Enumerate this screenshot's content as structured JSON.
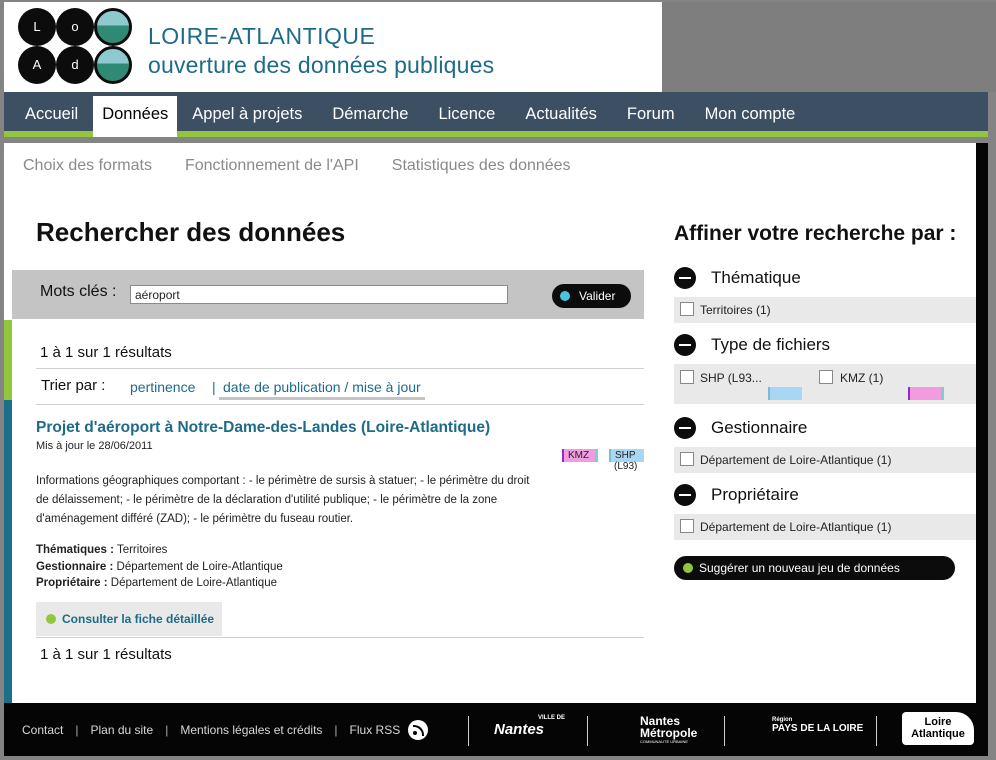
{
  "header": {
    "logo_letters": [
      "L",
      "o",
      "A",
      "d"
    ],
    "title_line1": "LOIRE-ATLANTIQUE",
    "title_line2": "ouverture des données publiques"
  },
  "nav": {
    "items": [
      "Accueil",
      "Données",
      "Appel à projets",
      "Démarche",
      "Licence",
      "Actualités",
      "Forum",
      "Mon compte"
    ],
    "active": "Données"
  },
  "subnav": [
    "Choix des formats",
    "Fonctionnement de l'API",
    "Statistiques des données"
  ],
  "search": {
    "page_title": "Rechercher des données",
    "keywords_label": "Mots clés :",
    "keywords_value": "aéroport",
    "submit_label": "Valider"
  },
  "results": {
    "count_text": "1 à 1 sur 1 résultats",
    "sort_label": "Trier par :",
    "sort_options": [
      "pertinence",
      "date de publication / mise à jour"
    ],
    "sort_separator": "|",
    "item": {
      "title": "Projet d'aéroport à Notre-Dame-des-Landes (Loire-Atlantique)",
      "updated": "Mis à jour le  28/06/2011",
      "formats": [
        "KMZ",
        "SHP"
      ],
      "format_sub": "(L93)",
      "description": "Informations géographiques comportant : - le périmètre de sursis à statuer; - le périmètre du droit de délaissement; - le périmètre de la déclaration d'utilité publique; - le périmètre de la zone d'aménagement différé (ZAD); - le périmètre du fuseau routier.",
      "theme_label": "Thématiques :",
      "theme_value": " Territoires",
      "manager_label": "Gestionnaire :",
      "manager_value": " Département de Loire-Atlantique",
      "owner_label": "Propriétaire :",
      "owner_value": " Département de Loire-Atlantique",
      "details_button": "Consulter la fiche détaillée"
    }
  },
  "sidebar": {
    "title": "Affiner votre recherche par :",
    "facets": [
      {
        "label": "Thématique",
        "options": [
          "Territoires (1)"
        ]
      },
      {
        "label": "Type de fichiers",
        "options": [
          "SHP (L93...",
          "KMZ (1)"
        ]
      },
      {
        "label": "Gestionnaire",
        "options": [
          "Département de Loire-Atlantique (1)"
        ]
      },
      {
        "label": "Propriétaire",
        "options": [
          "Département de Loire-Atlantique (1)"
        ]
      }
    ],
    "suggest_button": "Suggérer un nouveau jeu de données"
  },
  "footer": {
    "links": [
      "Contact",
      "Plan du site",
      "Mentions légales et crédits",
      "Flux RSS"
    ],
    "separator": "|",
    "partners": [
      {
        "top": "VILLE DE",
        "name": "Nantes"
      },
      {
        "name": "Nantes",
        "sub": "Métropole",
        "tag": "COMMUNAUTÉ URBAINE"
      },
      {
        "top": "Région",
        "name": "PAYS DE LA LOIRE"
      },
      {
        "name": "Loire",
        "sub": "Atlantique"
      }
    ]
  },
  "colors": {
    "nav_bg": "#3c4f63",
    "accent_green": "#92c63f",
    "link_blue": "#1e6b88",
    "kmz": "#f29be0",
    "shp": "#a7d7f2"
  }
}
